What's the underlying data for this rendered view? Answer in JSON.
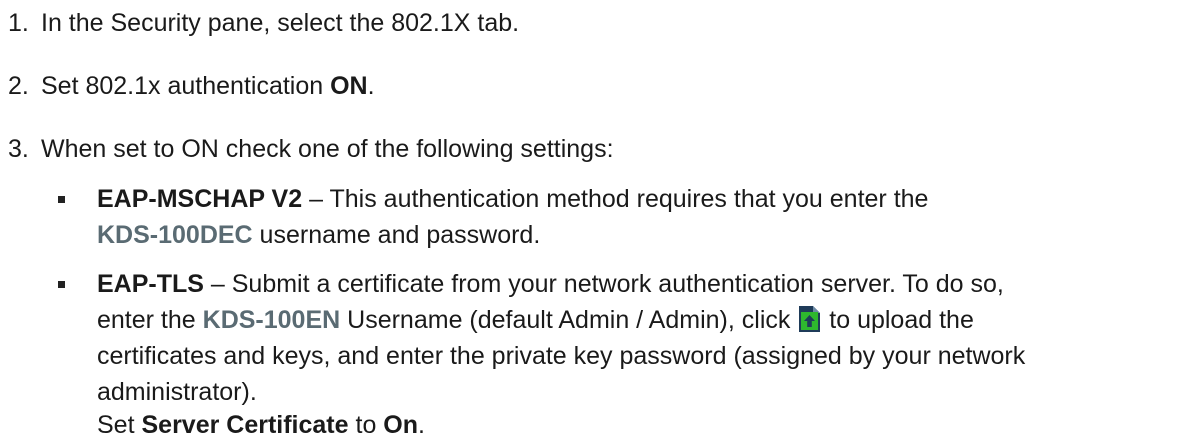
{
  "steps": [
    {
      "number": "1.",
      "text": "In the Security pane, select the 802.1X tab."
    },
    {
      "number": "2.",
      "text_before": "Set 802.1x authentication ",
      "bold": "ON",
      "text_after": "."
    },
    {
      "number": "3.",
      "text": "When set to ON check one of the following settings:"
    }
  ],
  "bullets": {
    "mschap": {
      "term": "EAP-MSCHAP V2",
      "line1_rest": " – This authentication method requires that you enter the",
      "product": "KDS-100DEC",
      "line2_rest": " username and password."
    },
    "tls": {
      "term": "EAP-TLS",
      "line1_rest": " – Submit a certificate from your network authentication server. To do so,",
      "line2_before": "enter the ",
      "product": "KDS-100EN",
      "line2_mid": " Username (default Admin / Admin), click ",
      "line2_after": " to upload the",
      "line3": "certificates and keys, and enter the private key password (assigned by your network",
      "line4": "administrator).",
      "line5_before": "Set ",
      "line5_bold1": "Server Certificate",
      "line5_mid": " to ",
      "line5_bold2": "On",
      "line5_after": "."
    }
  },
  "icons": {
    "upload": "upload-file-icon"
  },
  "colors": {
    "text": "#1a1a1a",
    "product": "#5a6b73",
    "icon_green": "#2eb82e",
    "icon_dark": "#1f3b59"
  }
}
